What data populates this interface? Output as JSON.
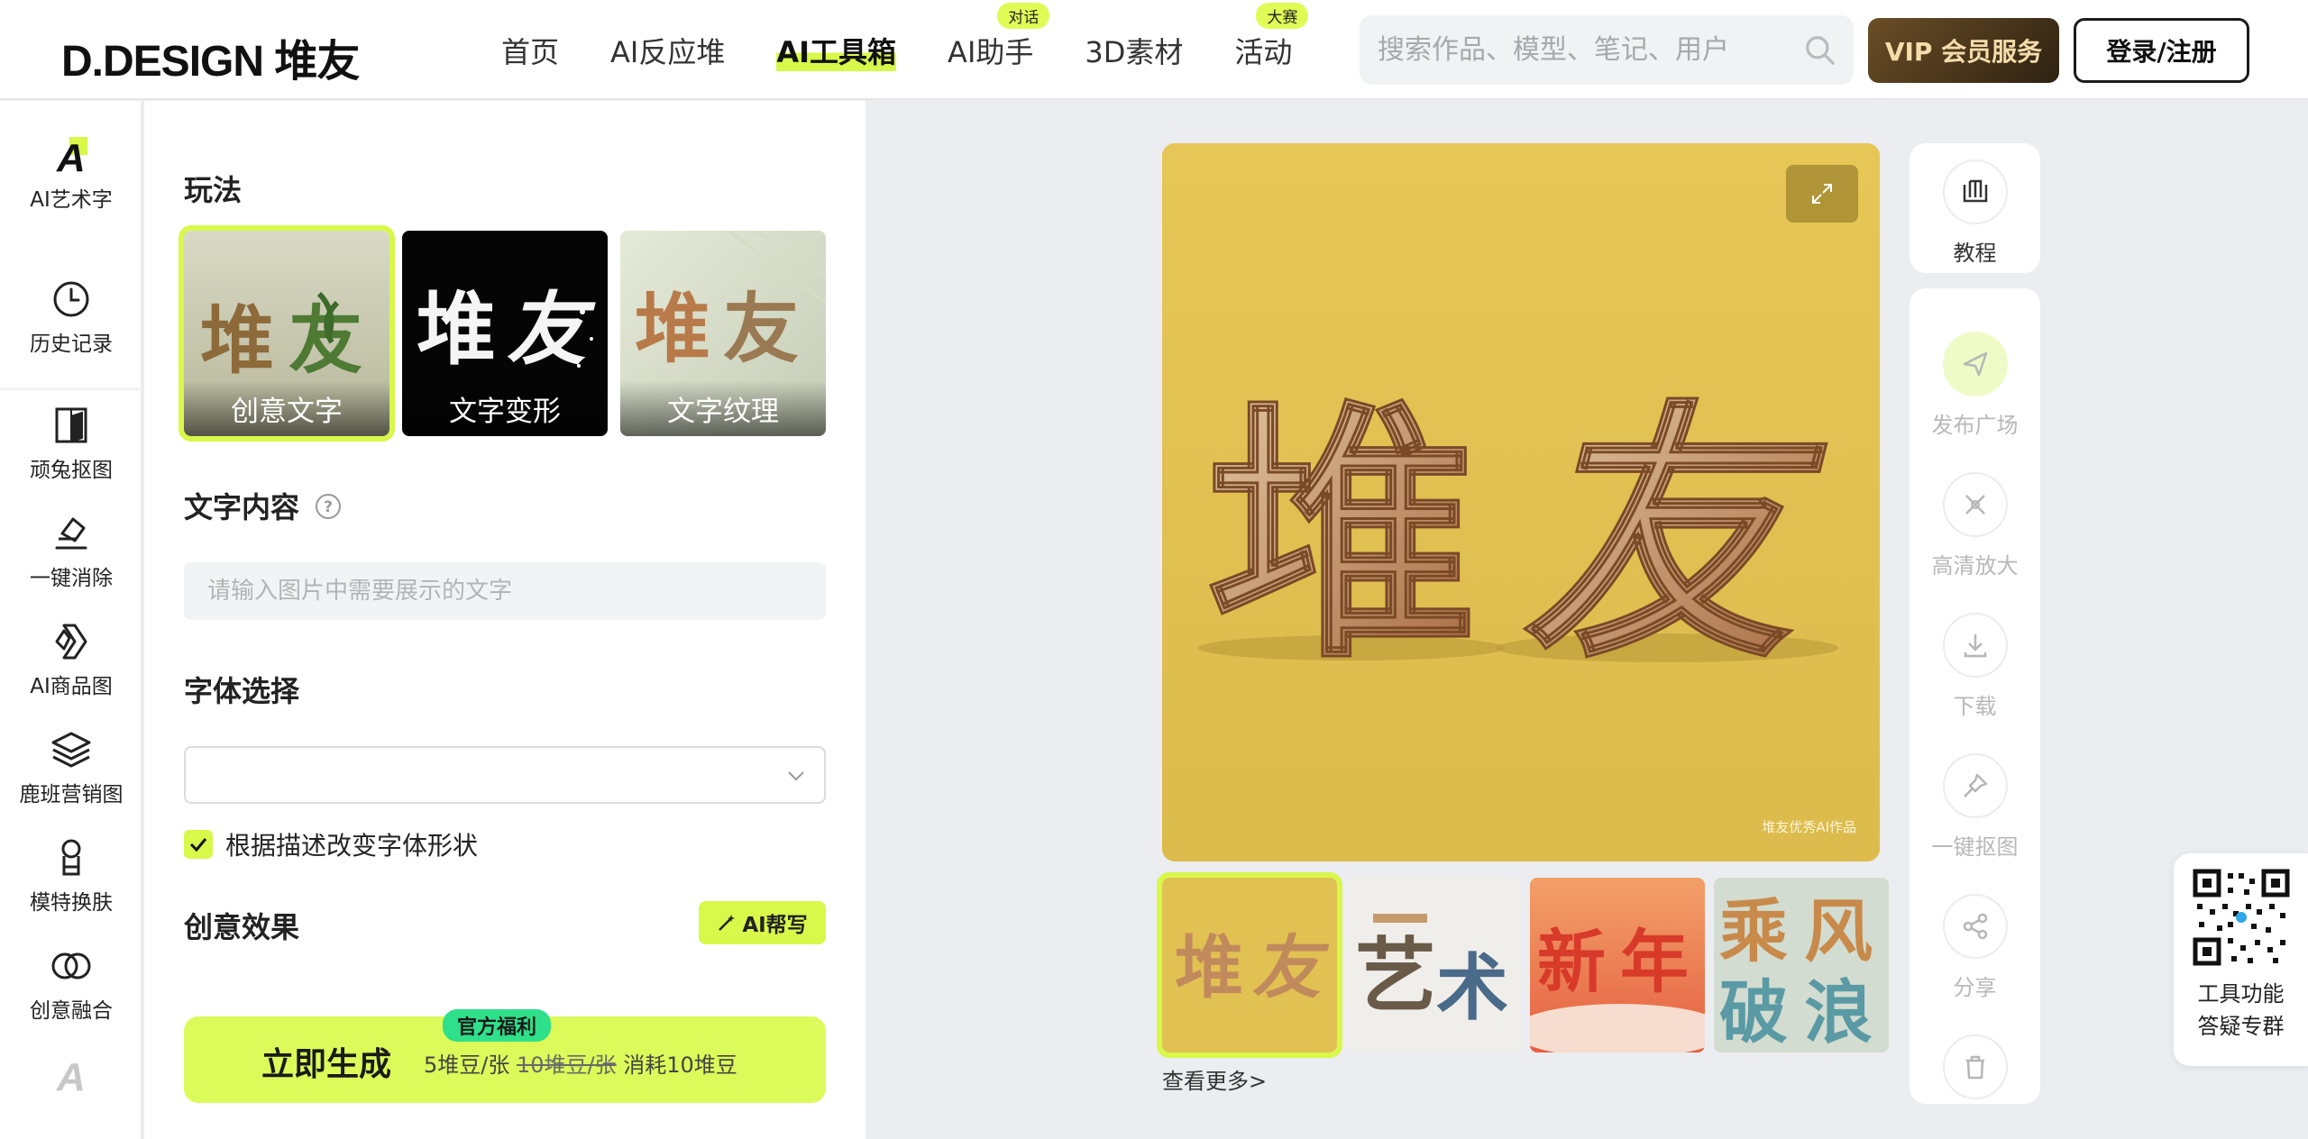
{
  "brand": {
    "logo": "D.DESIGN 堆友"
  },
  "nav": {
    "items": [
      {
        "label": "首页",
        "badge": ""
      },
      {
        "label": "AI反应堆",
        "badge": ""
      },
      {
        "label": "AI工具箱",
        "badge": ""
      },
      {
        "label": "AI助手",
        "badge": "对话"
      },
      {
        "label": "3D素材",
        "badge": ""
      },
      {
        "label": "活动",
        "badge": "大赛"
      }
    ],
    "search_placeholder": "搜索作品、模型、笔记、用户",
    "vip_label": "VIP 会员服务",
    "login_label": "登录/注册"
  },
  "rail": {
    "items": [
      {
        "label": "AI艺术字",
        "icon": "ai-art-text-icon"
      },
      {
        "label": "历史记录",
        "icon": "clock-icon"
      },
      {
        "label": "顽兔抠图",
        "icon": "cutout-icon"
      },
      {
        "label": "一键消除",
        "icon": "eraser-icon"
      },
      {
        "label": "AI商品图",
        "icon": "product-icon"
      },
      {
        "label": "鹿班营销图",
        "icon": "layers-icon"
      },
      {
        "label": "模特换肤",
        "icon": "model-icon"
      },
      {
        "label": "创意融合",
        "icon": "merge-icon"
      }
    ]
  },
  "panel": {
    "mode_title": "玩法",
    "modes": [
      {
        "label": "创意文字"
      },
      {
        "label": "文字变形"
      },
      {
        "label": "文字纹理"
      }
    ],
    "content_title": "文字内容",
    "content_placeholder": "请输入图片中需要展示的文字",
    "font_title": "字体选择",
    "font_value": "",
    "checkbox_label": "根据描述改变字体形状",
    "checkbox_checked": true,
    "effect_title": "创意效果",
    "ai_write_label": "AI帮写",
    "generate": {
      "label": "立即生成",
      "badge": "官方福利",
      "price": "5堆豆/张",
      "old_price": "10堆豆/张",
      "cost": "消耗10堆豆"
    }
  },
  "preview": {
    "watermark": "堆友优秀AI作品",
    "more_link": "查看更多>"
  },
  "actions": {
    "tutorial": "教程",
    "items": [
      "发布广场",
      "高清放大",
      "下载",
      "一键抠图",
      "分享"
    ]
  },
  "qr": {
    "line1": "工具功能",
    "line2": "答疑专群"
  },
  "colors": {
    "accent": "#d8f84a",
    "vip_start": "#6a4e26",
    "vip_end": "#2e2212",
    "preview_bg": "#e3c252"
  }
}
